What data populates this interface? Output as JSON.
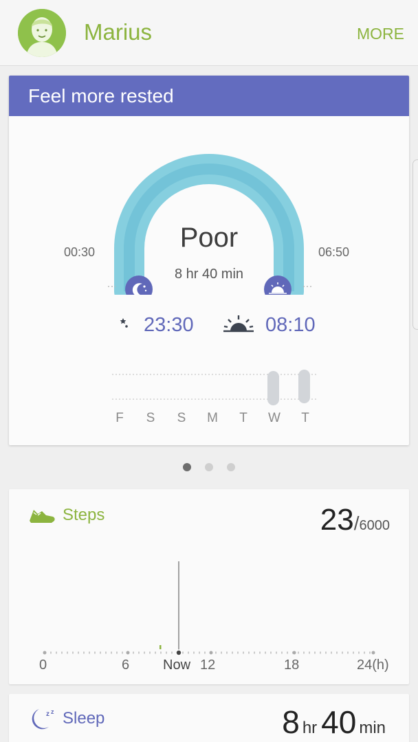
{
  "header": {
    "user_name": "Marius",
    "more_label": "MORE"
  },
  "sleep_card": {
    "banner": "Feel more rested",
    "quality": "Poor",
    "duration": "8 hr 40 min",
    "target_start": "00:30",
    "target_end": "06:50",
    "bed_time": "23:30",
    "wake_time": "08:10",
    "days": [
      "F",
      "S",
      "S",
      "M",
      "T",
      "W",
      "T"
    ]
  },
  "pager": {
    "pages": 3,
    "active": 0
  },
  "steps": {
    "label": "Steps",
    "count": "23",
    "separator": "/",
    "goal": "6000",
    "ticks": [
      "0",
      "6",
      "Now",
      "12",
      "18",
      "24(h)"
    ]
  },
  "sleep_summary": {
    "label": "Sleep",
    "hours": "8",
    "hours_unit": "hr",
    "minutes": "40",
    "minutes_unit": "min"
  },
  "colors": {
    "accent_green": "#8cb43f",
    "accent_indigo": "#636cbf",
    "gauge": "#7fcbde"
  }
}
